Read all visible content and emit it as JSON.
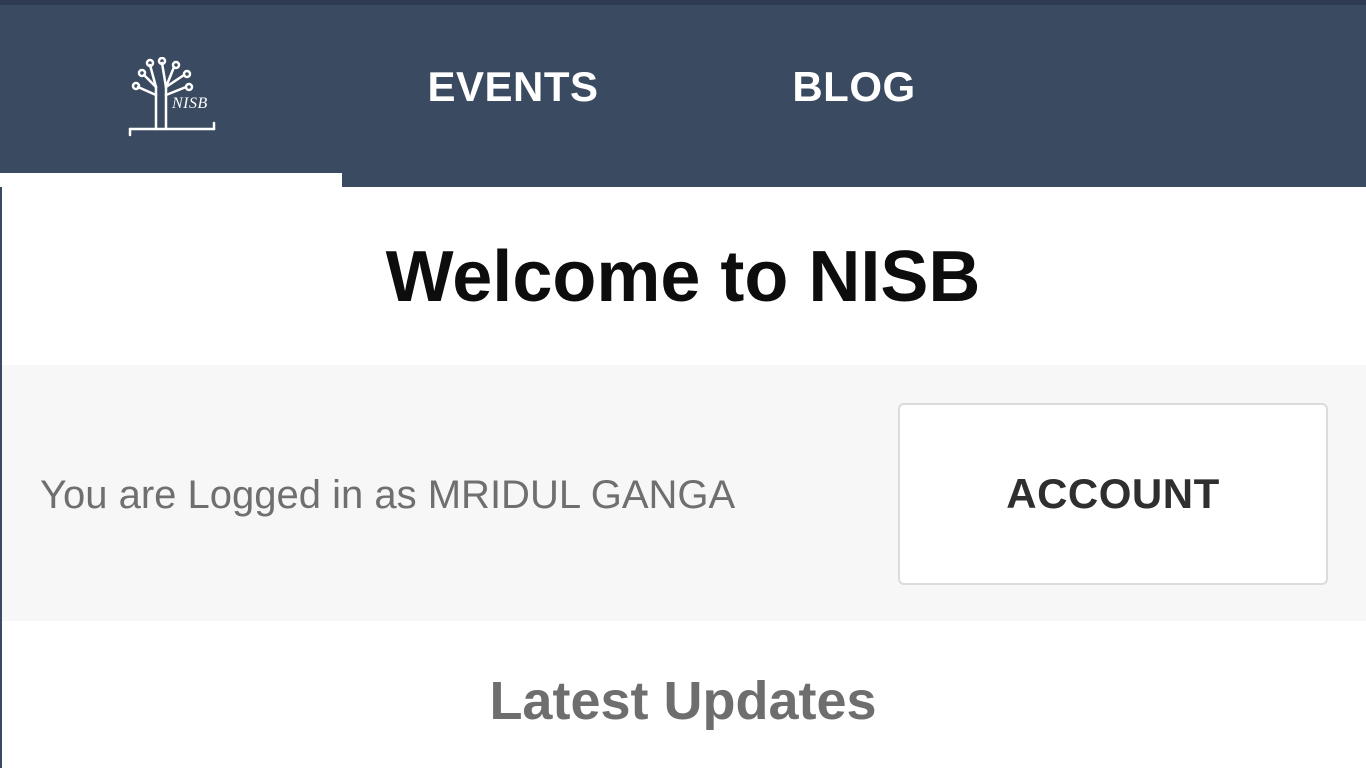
{
  "nav": {
    "logo_text": "NISB",
    "tabs": [
      {
        "id": "home",
        "label": ""
      },
      {
        "id": "events",
        "label": "EVENTS"
      },
      {
        "id": "blog",
        "label": "BLOG"
      },
      {
        "id": "notifications",
        "icon": "bell-icon"
      }
    ],
    "active_tab": "home"
  },
  "main": {
    "welcome_title": "Welcome to NISB",
    "login_status": "You are Logged in as MRIDUL GANGA",
    "account_button_label": "ACCOUNT",
    "latest_updates_heading": "Latest Updates"
  },
  "colors": {
    "nav_background": "#3a4a61",
    "nav_text": "#ffffff",
    "panel_background": "#f7f7f7",
    "title_text": "#0d0d0d",
    "muted_text": "#6f6f6f"
  }
}
